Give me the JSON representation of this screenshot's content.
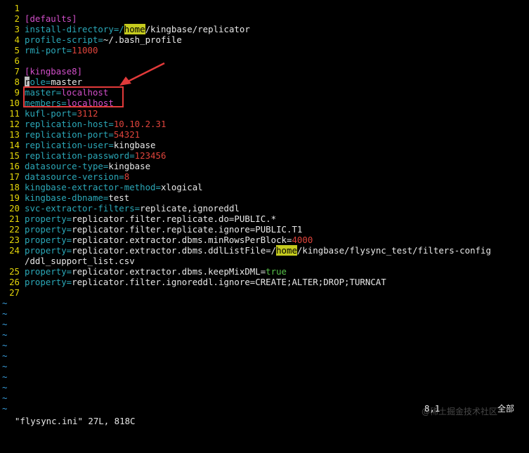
{
  "editor": {
    "lines": [
      {
        "n": "1",
        "segs": []
      },
      {
        "n": "2",
        "segs": [
          {
            "t": "[defaults]",
            "c": "sec"
          }
        ]
      },
      {
        "n": "3",
        "segs": [
          {
            "t": "install-directory=",
            "c": "key"
          },
          {
            "t": "/",
            "c": "key"
          },
          {
            "t": "home",
            "c": "hl"
          },
          {
            "t": "/kingbase/replicator",
            "c": "val"
          }
        ]
      },
      {
        "n": "4",
        "segs": [
          {
            "t": "profile-script=",
            "c": "key"
          },
          {
            "t": "~/.bash_profile",
            "c": "val"
          }
        ]
      },
      {
        "n": "5",
        "segs": [
          {
            "t": "rmi-port=",
            "c": "key"
          },
          {
            "t": "11000",
            "c": "num"
          }
        ]
      },
      {
        "n": "6",
        "segs": []
      },
      {
        "n": "7",
        "segs": [
          {
            "t": "[kingbase8]",
            "c": "sec"
          }
        ]
      },
      {
        "n": "8",
        "segs": [
          {
            "t": "r",
            "c": "cursor"
          },
          {
            "t": "ole=",
            "c": "key"
          },
          {
            "t": "master",
            "c": "val"
          }
        ]
      },
      {
        "n": "9",
        "segs": [
          {
            "t": "master=",
            "c": "key"
          },
          {
            "t": "localhost",
            "c": "sec"
          }
        ]
      },
      {
        "n": "10",
        "segs": [
          {
            "t": "members=",
            "c": "key"
          },
          {
            "t": "localhost",
            "c": "sec"
          }
        ]
      },
      {
        "n": "11",
        "segs": [
          {
            "t": "kufl-port=",
            "c": "key"
          },
          {
            "t": "3112",
            "c": "num"
          }
        ]
      },
      {
        "n": "12",
        "segs": [
          {
            "t": "replication-host=",
            "c": "key"
          },
          {
            "t": "10.10.2.31",
            "c": "num"
          }
        ]
      },
      {
        "n": "13",
        "segs": [
          {
            "t": "replication-port=",
            "c": "key"
          },
          {
            "t": "54321",
            "c": "num"
          }
        ]
      },
      {
        "n": "14",
        "segs": [
          {
            "t": "replication-user=",
            "c": "key"
          },
          {
            "t": "kingbase",
            "c": "val"
          }
        ]
      },
      {
        "n": "15",
        "segs": [
          {
            "t": "replication-password=",
            "c": "key"
          },
          {
            "t": "123456",
            "c": "num"
          }
        ]
      },
      {
        "n": "16",
        "segs": [
          {
            "t": "datasource-type=",
            "c": "key"
          },
          {
            "t": "kingbase",
            "c": "val"
          }
        ]
      },
      {
        "n": "17",
        "segs": [
          {
            "t": "datasource-version=",
            "c": "key"
          },
          {
            "t": "8",
            "c": "num"
          }
        ]
      },
      {
        "n": "18",
        "segs": [
          {
            "t": "kingbase-extractor-method=",
            "c": "key"
          },
          {
            "t": "xlogical",
            "c": "val"
          }
        ]
      },
      {
        "n": "19",
        "segs": [
          {
            "t": "kingbase-dbname=",
            "c": "key"
          },
          {
            "t": "test",
            "c": "val"
          }
        ]
      },
      {
        "n": "20",
        "segs": [
          {
            "t": "svc-extractor-filters=",
            "c": "key"
          },
          {
            "t": "replicate,ignoreddl",
            "c": "val"
          }
        ]
      },
      {
        "n": "21",
        "segs": [
          {
            "t": "property=",
            "c": "key"
          },
          {
            "t": "replicator.filter.replicate.do=PUBLIC.*",
            "c": "val"
          }
        ]
      },
      {
        "n": "22",
        "segs": [
          {
            "t": "property=",
            "c": "key"
          },
          {
            "t": "replicator.filter.replicate.ignore=PUBLIC.T1",
            "c": "val"
          }
        ]
      },
      {
        "n": "23",
        "segs": [
          {
            "t": "property=",
            "c": "key"
          },
          {
            "t": "replicator.extractor.dbms.minRowsPerBlock=",
            "c": "val"
          },
          {
            "t": "4000",
            "c": "num"
          }
        ]
      },
      {
        "n": "24",
        "segs": [
          {
            "t": "property=",
            "c": "key"
          },
          {
            "t": "replicator.extractor.dbms.ddlListFile=/",
            "c": "val"
          },
          {
            "t": "home",
            "c": "hl"
          },
          {
            "t": "/kingbase/flysync_test/filters-config",
            "c": "val"
          }
        ]
      },
      {
        "n": "",
        "segs": [
          {
            "t": "/ddl_support_list.csv",
            "c": "val"
          }
        ]
      },
      {
        "n": "25",
        "segs": [
          {
            "t": "property=",
            "c": "key"
          },
          {
            "t": "replicator.extractor.dbms.keepMixDML=",
            "c": "val"
          },
          {
            "t": "true",
            "c": "kw"
          }
        ]
      },
      {
        "n": "26",
        "segs": [
          {
            "t": "property=",
            "c": "key"
          },
          {
            "t": "replicator.filter.ignoreddl.ignore=CREATE;ALTER;DROP;TURNCAT",
            "c": "val"
          }
        ]
      },
      {
        "n": "27",
        "segs": []
      }
    ],
    "tilde_char": "~",
    "tilde_count": 11
  },
  "status": {
    "file_info": "\"flysync.ini\" 27L, 818C",
    "cursor_pos": "8,1",
    "view": "全部"
  },
  "watermark": "@稀土掘金技术社区",
  "colors": {
    "background": "#000000",
    "line_number": "#e5d70a",
    "key": "#2ba8b8",
    "section": "#d24fc9",
    "number": "#e0443c",
    "highlight": "#c5cb1e",
    "annotation": "#e23a3a"
  }
}
